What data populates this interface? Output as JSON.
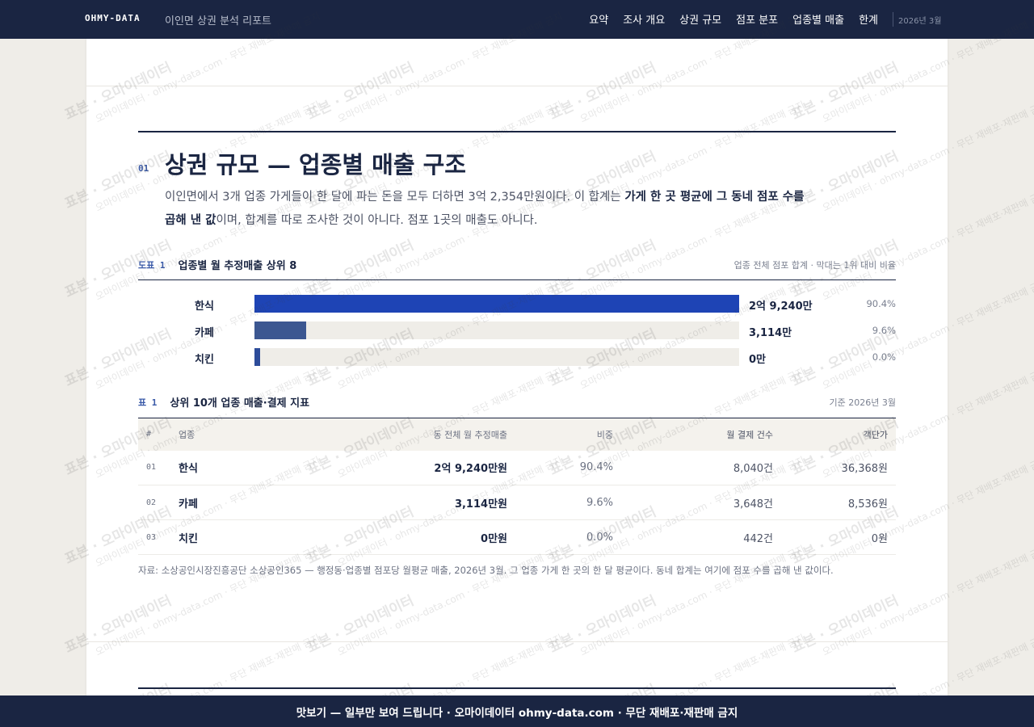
{
  "header": {
    "brand": "OHMY-DATA",
    "report_title": "이인면 상권 분석 리포트",
    "nav": [
      "요약",
      "조사 개요",
      "상권 규모",
      "점포 분포",
      "업종별 매출",
      "한계"
    ],
    "date": "2026년 3월"
  },
  "section": {
    "number": "01",
    "title": "상권 규모 — 업종별 매출 구조",
    "lead_1": "이인면에서 3개 업종 가게들이 한 달에 파는 돈을 모두 더하면 3억 2,354만원이다. 이 합계는 ",
    "lead_bold": "가게 한 곳 평균에 그 동네 점포 수를 곱해 낸 값",
    "lead_2": "이며, 합계를 따로 조사한 것이 아니다. 점포 1곳의 매출도 아니다."
  },
  "figure": {
    "tag": "도표 1",
    "title": "업종별 월 추정매출 상위 8",
    "note": "업종 전체 점포 합계 · 막대는 1위 대비 비율"
  },
  "chart_data": {
    "type": "bar",
    "orientation": "horizontal",
    "categories": [
      "한식",
      "카페",
      "치킨"
    ],
    "values": [
      29240,
      3114,
      0
    ],
    "value_labels": [
      "2억 9,240만",
      "3,114만",
      "0만"
    ],
    "share_labels": [
      "90.4%",
      "9.6%",
      "0.0%"
    ],
    "unit": "만원",
    "colors": [
      "#1e44b5",
      "#3c5791",
      "#2d4c9a"
    ]
  },
  "table": {
    "tag": "표 1",
    "title": "상위 10개 업종 매출·결제 지표",
    "note": "기준 2026년 3월",
    "columns": [
      "#",
      "업종",
      "동 전체 월 추정매출",
      "비중",
      "월 결제 건수",
      "객단가"
    ],
    "rows": [
      {
        "num": "01",
        "name": "한식",
        "sales": "2억 9,240만원",
        "share": "90.4%",
        "count": "8,040건",
        "price": "36,368원"
      },
      {
        "num": "02",
        "name": "카페",
        "sales": "3,114만원",
        "share": "9.6%",
        "count": "3,648건",
        "price": "8,536원"
      },
      {
        "num": "03",
        "name": "치킨",
        "sales": "0만원",
        "share": "0.0%",
        "count": "442건",
        "price": "0원"
      }
    ]
  },
  "source": "자료: 소상공인시장진흥공단 소상공인365 — 행정동·업종별 점포당 월평균 매출, 2026년 3월. 그 업종 가게 한 곳의 한 달 평균이다. 동네 합계는 여기에 점포 수를 곱해 낸 값이다.",
  "watermark": {
    "big": "표본 · 오마이데이터",
    "small": "오마이데이터 · ohmy-data.com · 무단 재배포·재판매 금지"
  },
  "banner": "맛보기 — 일부만 보여 드립니다 · 오마이데이터 ohmy-data.com · 무단 재배포·재판매 금지"
}
